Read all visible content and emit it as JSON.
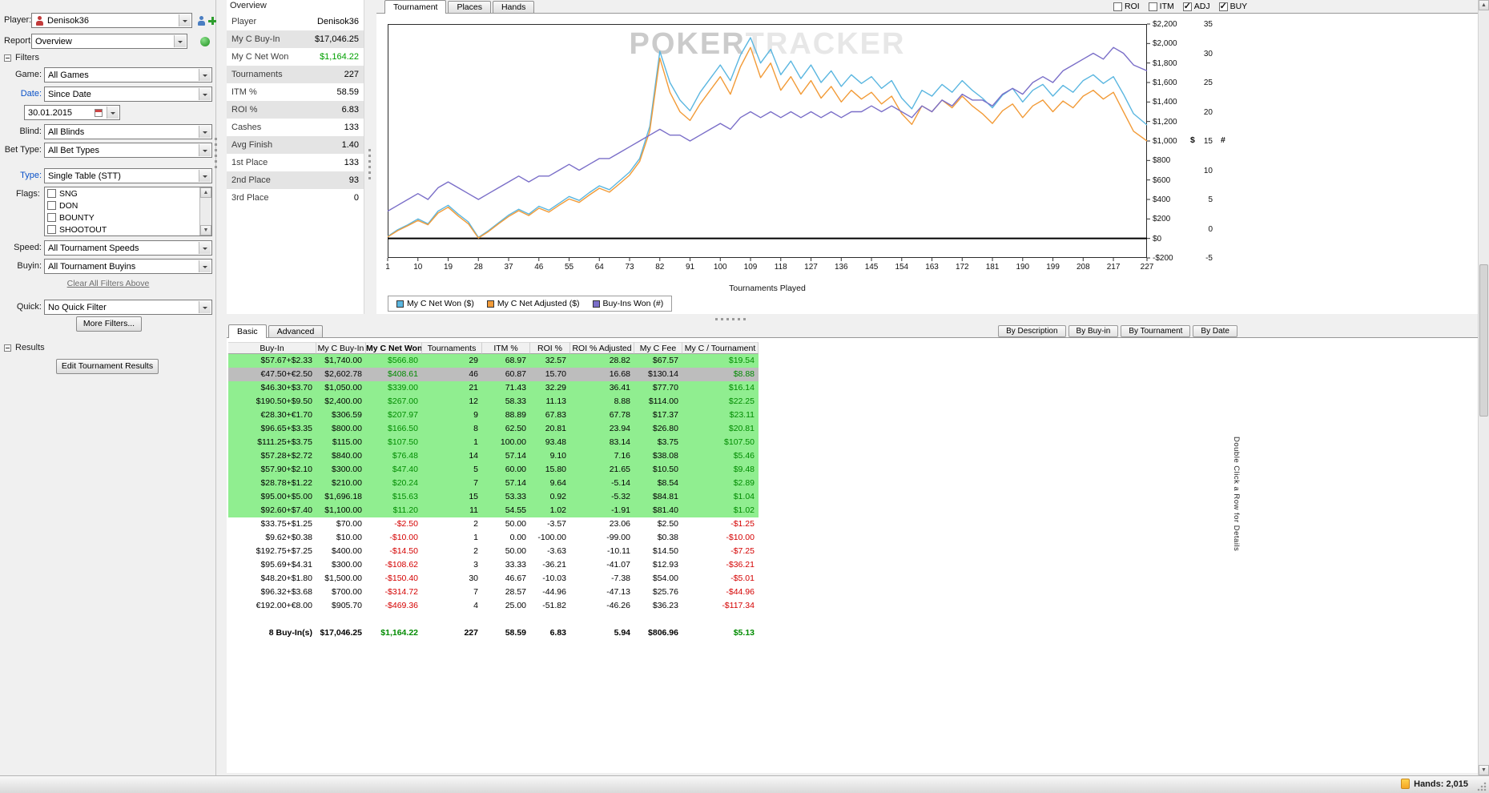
{
  "sidebar": {
    "player": {
      "label": "Player:",
      "value": "Denisok36"
    },
    "report": {
      "label": "Report:",
      "value": "Overview"
    },
    "filters_header": "Filters",
    "filters": {
      "game": {
        "label": "Game:",
        "value": "All Games"
      },
      "date": {
        "label": "Date:",
        "value": "Since Date"
      },
      "date_value": "30.01.2015",
      "blind": {
        "label": "Blind:",
        "value": "All Blinds"
      },
      "bet_type": {
        "label": "Bet Type:",
        "value": "All Bet Types"
      },
      "type": {
        "label": "Type:",
        "value": "Single Table (STT)"
      },
      "flags_label": "Flags:",
      "flags_options": [
        "SNG",
        "DON",
        "BOUNTY",
        "SHOOTOUT"
      ],
      "speed": {
        "label": "Speed:",
        "value": "All Tournament Speeds"
      },
      "buyin": {
        "label": "Buyin:",
        "value": "All Tournament Buyins"
      },
      "clear_link": "Clear All Filters Above",
      "quick": {
        "label": "Quick:",
        "value": "No Quick Filter"
      },
      "more_filters_button": "More Filters..."
    },
    "results_header": "Results",
    "edit_results_button": "Edit Tournament Results"
  },
  "overview_panel": {
    "title": "Overview",
    "stats": [
      {
        "label": "Player",
        "value": "Denisok36"
      },
      {
        "label": "My C Buy-In",
        "value": "$17,046.25"
      },
      {
        "label": "My C Net Won",
        "value": "$1,164.22",
        "positive": true
      },
      {
        "label": "Tournaments",
        "value": "227"
      },
      {
        "label": "ITM %",
        "value": "58.59"
      },
      {
        "label": "ROI %",
        "value": "6.83"
      },
      {
        "label": "Cashes",
        "value": "133"
      },
      {
        "label": "Avg Finish",
        "value": "1.40"
      },
      {
        "label": "1st Place",
        "value": "133"
      },
      {
        "label": "2nd Place",
        "value": "93"
      },
      {
        "label": "3rd Place",
        "value": "0"
      }
    ]
  },
  "chart_panel": {
    "tabs": [
      "Tournament",
      "Places",
      "Hands"
    ],
    "active_tab": "Tournament",
    "checkboxes": [
      {
        "label": "ROI",
        "checked": false
      },
      {
        "label": "ITM",
        "checked": false
      },
      {
        "label": "ADJ",
        "checked": true
      },
      {
        "label": "BUY",
        "checked": true
      }
    ],
    "watermark": {
      "part1": "POKER",
      "part2": "TRACKER"
    },
    "legend": [
      {
        "label": "My C Net Won ($)",
        "color": "#5ab6e0"
      },
      {
        "label": "My C Net Adjusted ($)",
        "color": "#f29b38"
      },
      {
        "label": "Buy-Ins Won (#)",
        "color": "#7a6ec8"
      }
    ],
    "chart_data": {
      "type": "line",
      "title": "",
      "xlabel": "Tournaments Played",
      "x_min": 1,
      "x_max": 227,
      "x_ticks": [
        1,
        10,
        19,
        28,
        37,
        46,
        55,
        64,
        73,
        82,
        91,
        100,
        109,
        118,
        127,
        136,
        145,
        154,
        163,
        172,
        181,
        190,
        199,
        208,
        217,
        227
      ],
      "left_axis": {
        "label": "$",
        "min": -200,
        "max": 2200,
        "step": 200
      },
      "right_axis": {
        "label": "#",
        "min": -5,
        "max": 35,
        "step": 5
      },
      "grid": false,
      "legend_position": "bottom-left",
      "x_points": [
        1,
        4,
        7,
        10,
        13,
        16,
        19,
        22,
        25,
        28,
        31,
        34,
        37,
        40,
        43,
        46,
        49,
        52,
        55,
        58,
        61,
        64,
        67,
        70,
        73,
        76,
        79,
        82,
        85,
        88,
        91,
        94,
        97,
        100,
        103,
        106,
        109,
        112,
        115,
        118,
        121,
        124,
        127,
        130,
        133,
        136,
        139,
        142,
        145,
        148,
        151,
        154,
        157,
        160,
        163,
        166,
        169,
        172,
        175,
        178,
        181,
        184,
        187,
        190,
        193,
        196,
        199,
        202,
        205,
        208,
        211,
        214,
        217,
        220,
        223,
        227
      ],
      "series": [
        {
          "id": "my-c-net-won",
          "name": "My C Net Won ($)",
          "axis": "left",
          "color": "#5ab6e0",
          "y": [
            20,
            90,
            140,
            200,
            150,
            280,
            340,
            250,
            170,
            10,
            80,
            160,
            240,
            300,
            250,
            330,
            290,
            360,
            430,
            390,
            470,
            540,
            500,
            590,
            680,
            820,
            1150,
            1920,
            1600,
            1420,
            1310,
            1500,
            1640,
            1780,
            1620,
            1880,
            2060,
            1800,
            1940,
            1680,
            1820,
            1640,
            1780,
            1600,
            1720,
            1560,
            1680,
            1590,
            1660,
            1540,
            1620,
            1440,
            1330,
            1520,
            1460,
            1580,
            1500,
            1620,
            1520,
            1440,
            1340,
            1470,
            1540,
            1400,
            1520,
            1580,
            1460,
            1570,
            1500,
            1620,
            1680,
            1590,
            1660,
            1480,
            1280,
            1164
          ]
        },
        {
          "id": "my-c-net-adjusted",
          "name": "My C Net Adjusted ($)",
          "axis": "left",
          "color": "#f29b38",
          "y": [
            15,
            80,
            130,
            185,
            140,
            260,
            320,
            230,
            150,
            5,
            70,
            150,
            225,
            285,
            235,
            310,
            270,
            340,
            405,
            370,
            445,
            515,
            475,
            560,
            650,
            790,
            1100,
            1850,
            1500,
            1300,
            1210,
            1380,
            1520,
            1660,
            1480,
            1760,
            1960,
            1650,
            1800,
            1520,
            1660,
            1480,
            1620,
            1440,
            1560,
            1400,
            1520,
            1430,
            1500,
            1380,
            1460,
            1280,
            1170,
            1360,
            1300,
            1420,
            1340,
            1460,
            1360,
            1280,
            1180,
            1310,
            1380,
            1240,
            1360,
            1420,
            1300,
            1410,
            1340,
            1460,
            1520,
            1430,
            1500,
            1300,
            1100,
            1000
          ]
        },
        {
          "id": "buy-ins-won",
          "name": "Buy-Ins Won (#)",
          "axis": "right",
          "color": "#7a6ec8",
          "y": [
            3,
            4,
            5,
            6,
            5,
            7,
            8,
            7,
            6,
            5,
            6,
            7,
            8,
            9,
            8,
            9,
            9,
            10,
            11,
            10,
            11,
            12,
            12,
            13,
            14,
            15,
            16,
            17,
            16,
            16,
            15,
            16,
            17,
            18,
            17,
            19,
            20,
            19,
            20,
            19,
            20,
            19,
            20,
            19,
            20,
            19,
            20,
            20,
            21,
            20,
            21,
            20,
            19,
            21,
            20,
            22,
            21,
            23,
            22,
            22,
            21,
            23,
            24,
            23,
            25,
            26,
            25,
            27,
            28,
            29,
            30,
            29,
            31,
            30,
            28,
            27
          ]
        }
      ]
    }
  },
  "table_panel": {
    "tabs": [
      "Basic",
      "Advanced"
    ],
    "active_tab": "Basic",
    "sort_buttons": [
      "By Description",
      "By Buy-in",
      "By Tournament",
      "By Date"
    ],
    "columns": [
      "Buy-In",
      "My C Buy-In",
      "My C Net Won",
      "Tournaments",
      "ITM %",
      "ROI %",
      "ROI % Adjusted",
      "My C Fee",
      "My C / Tournament"
    ],
    "sorted_column": "My C Net Won",
    "rows": [
      {
        "state": "gain",
        "cells": [
          "$57.67+$2.33",
          "$1,740.00",
          "$566.80",
          "29",
          "68.97",
          "32.57",
          "28.82",
          "$67.57",
          "$19.54"
        ]
      },
      {
        "state": "selected",
        "cells": [
          "€47.50+€2.50",
          "$2,602.78",
          "$408.61",
          "46",
          "60.87",
          "15.70",
          "16.68",
          "$130.14",
          "$8.88"
        ]
      },
      {
        "state": "gain",
        "cells": [
          "$46.30+$3.70",
          "$1,050.00",
          "$339.00",
          "21",
          "71.43",
          "32.29",
          "36.41",
          "$77.70",
          "$16.14"
        ]
      },
      {
        "state": "gain",
        "cells": [
          "$190.50+$9.50",
          "$2,400.00",
          "$267.00",
          "12",
          "58.33",
          "11.13",
          "8.88",
          "$114.00",
          "$22.25"
        ]
      },
      {
        "state": "gain",
        "cells": [
          "€28.30+€1.70",
          "$306.59",
          "$207.97",
          "9",
          "88.89",
          "67.83",
          "67.78",
          "$17.37",
          "$23.11"
        ]
      },
      {
        "state": "gain",
        "cells": [
          "$96.65+$3.35",
          "$800.00",
          "$166.50",
          "8",
          "62.50",
          "20.81",
          "23.94",
          "$26.80",
          "$20.81"
        ]
      },
      {
        "state": "gain",
        "cells": [
          "$111.25+$3.75",
          "$115.00",
          "$107.50",
          "1",
          "100.00",
          "93.48",
          "83.14",
          "$3.75",
          "$107.50"
        ]
      },
      {
        "state": "gain",
        "cells": [
          "$57.28+$2.72",
          "$840.00",
          "$76.48",
          "14",
          "57.14",
          "9.10",
          "7.16",
          "$38.08",
          "$5.46"
        ]
      },
      {
        "state": "gain",
        "cells": [
          "$57.90+$2.10",
          "$300.00",
          "$47.40",
          "5",
          "60.00",
          "15.80",
          "21.65",
          "$10.50",
          "$9.48"
        ]
      },
      {
        "state": "gain",
        "cells": [
          "$28.78+$1.22",
          "$210.00",
          "$20.24",
          "7",
          "57.14",
          "9.64",
          "-5.14",
          "$8.54",
          "$2.89"
        ]
      },
      {
        "state": "gain",
        "cells": [
          "$95.00+$5.00",
          "$1,696.18",
          "$15.63",
          "15",
          "53.33",
          "0.92",
          "-5.32",
          "$84.81",
          "$1.04"
        ]
      },
      {
        "state": "gain",
        "cells": [
          "$92.60+$7.40",
          "$1,100.00",
          "$11.20",
          "11",
          "54.55",
          "1.02",
          "-1.91",
          "$81.40",
          "$1.02"
        ]
      },
      {
        "state": "loss",
        "cells": [
          "$33.75+$1.25",
          "$70.00",
          "-$2.50",
          "2",
          "50.00",
          "-3.57",
          "23.06",
          "$2.50",
          "-$1.25"
        ]
      },
      {
        "state": "loss",
        "cells": [
          "$9.62+$0.38",
          "$10.00",
          "-$10.00",
          "1",
          "0.00",
          "-100.00",
          "-99.00",
          "$0.38",
          "-$10.00"
        ]
      },
      {
        "state": "loss",
        "cells": [
          "$192.75+$7.25",
          "$400.00",
          "-$14.50",
          "2",
          "50.00",
          "-3.63",
          "-10.11",
          "$14.50",
          "-$7.25"
        ]
      },
      {
        "state": "loss",
        "cells": [
          "$95.69+$4.31",
          "$300.00",
          "-$108.62",
          "3",
          "33.33",
          "-36.21",
          "-41.07",
          "$12.93",
          "-$36.21"
        ]
      },
      {
        "state": "loss",
        "cells": [
          "$48.20+$1.80",
          "$1,500.00",
          "-$150.40",
          "30",
          "46.67",
          "-10.03",
          "-7.38",
          "$54.00",
          "-$5.01"
        ]
      },
      {
        "state": "loss",
        "cells": [
          "$96.32+$3.68",
          "$700.00",
          "-$314.72",
          "7",
          "28.57",
          "-44.96",
          "-47.13",
          "$25.76",
          "-$44.96"
        ]
      },
      {
        "state": "loss",
        "cells": [
          "€192.00+€8.00",
          "$905.70",
          "-$469.36",
          "4",
          "25.00",
          "-51.82",
          "-46.26",
          "$36.23",
          "-$117.34"
        ]
      }
    ],
    "total_row": [
      "8 Buy-In(s)",
      "$17,046.25",
      "$1,164.22",
      "227",
      "58.59",
      "6.83",
      "5.94",
      "$806.96",
      "$5.13"
    ],
    "side_note": "Double Click a Row for Details"
  },
  "status_bar": {
    "hands": "Hands: 2,015"
  }
}
